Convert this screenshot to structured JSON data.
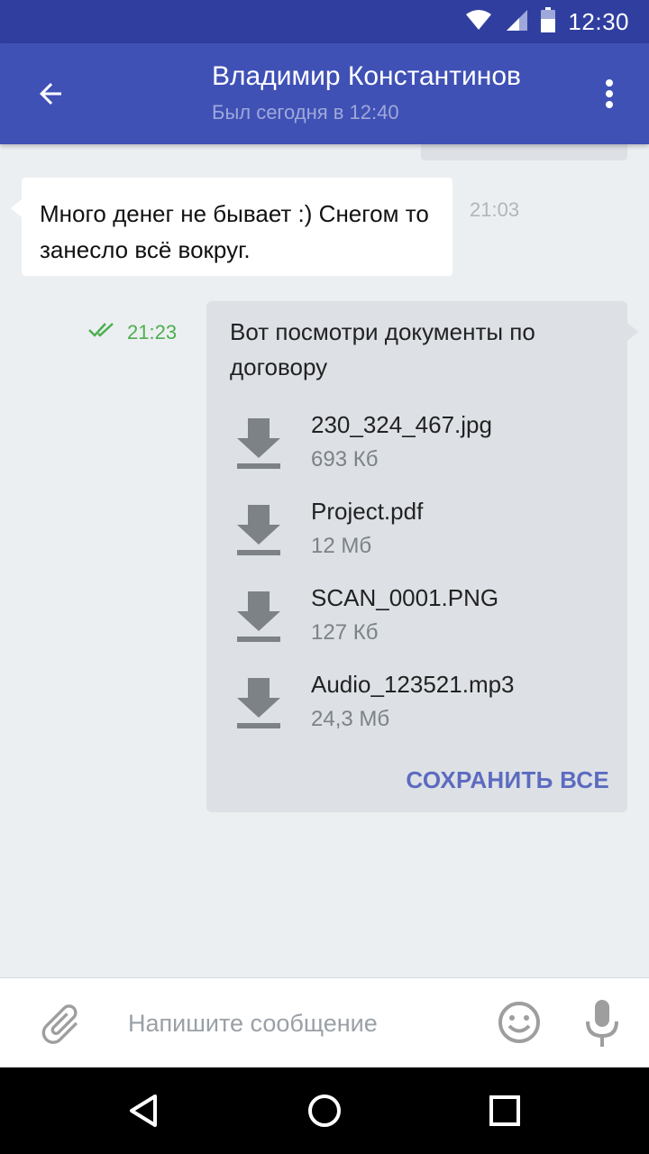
{
  "status_bar": {
    "time": "12:30",
    "icons": [
      "wifi-icon",
      "signal-icon",
      "battery-icon"
    ]
  },
  "app_bar": {
    "contact_name": "Владимир Константинов",
    "last_seen": "Был сегодня в 12:40",
    "back_icon": "arrow-back-icon",
    "menu_icon": "more-vert-icon"
  },
  "messages": {
    "incoming": {
      "text": "Много денег не бывает :)  Снегом то занесло всё вокруг.",
      "time": "21:03"
    },
    "outgoing": {
      "time": "21:23",
      "status_icon": "double-check-icon",
      "text": "Вот посмотри документы по договору",
      "files": [
        {
          "name": "230_324_467.jpg",
          "size": "693 Кб",
          "icon": "download-icon"
        },
        {
          "name": "Project.pdf",
          "size": "12 Мб",
          "icon": "download-icon"
        },
        {
          "name": "SCAN_0001.PNG",
          "size": "127 Кб",
          "icon": "download-icon"
        },
        {
          "name": "Audio_123521.mp3",
          "size": "24,3 Мб",
          "icon": "download-icon"
        }
      ],
      "save_all_label": "СОХРАНИТЬ ВСЕ"
    }
  },
  "input_bar": {
    "placeholder": "Напишите сообщение",
    "value": "",
    "icons": [
      "paperclip-icon",
      "emoji-icon",
      "mic-icon"
    ]
  },
  "nav_bar": {
    "icons": [
      "nav-back-icon",
      "nav-home-icon",
      "nav-recents-icon"
    ]
  },
  "colors": {
    "status_bar": "#303f9f",
    "app_bar": "#3f51b5",
    "accent": "#5c6bc0",
    "sent_status": "#4caf50",
    "chat_bg": "#eceff1"
  }
}
